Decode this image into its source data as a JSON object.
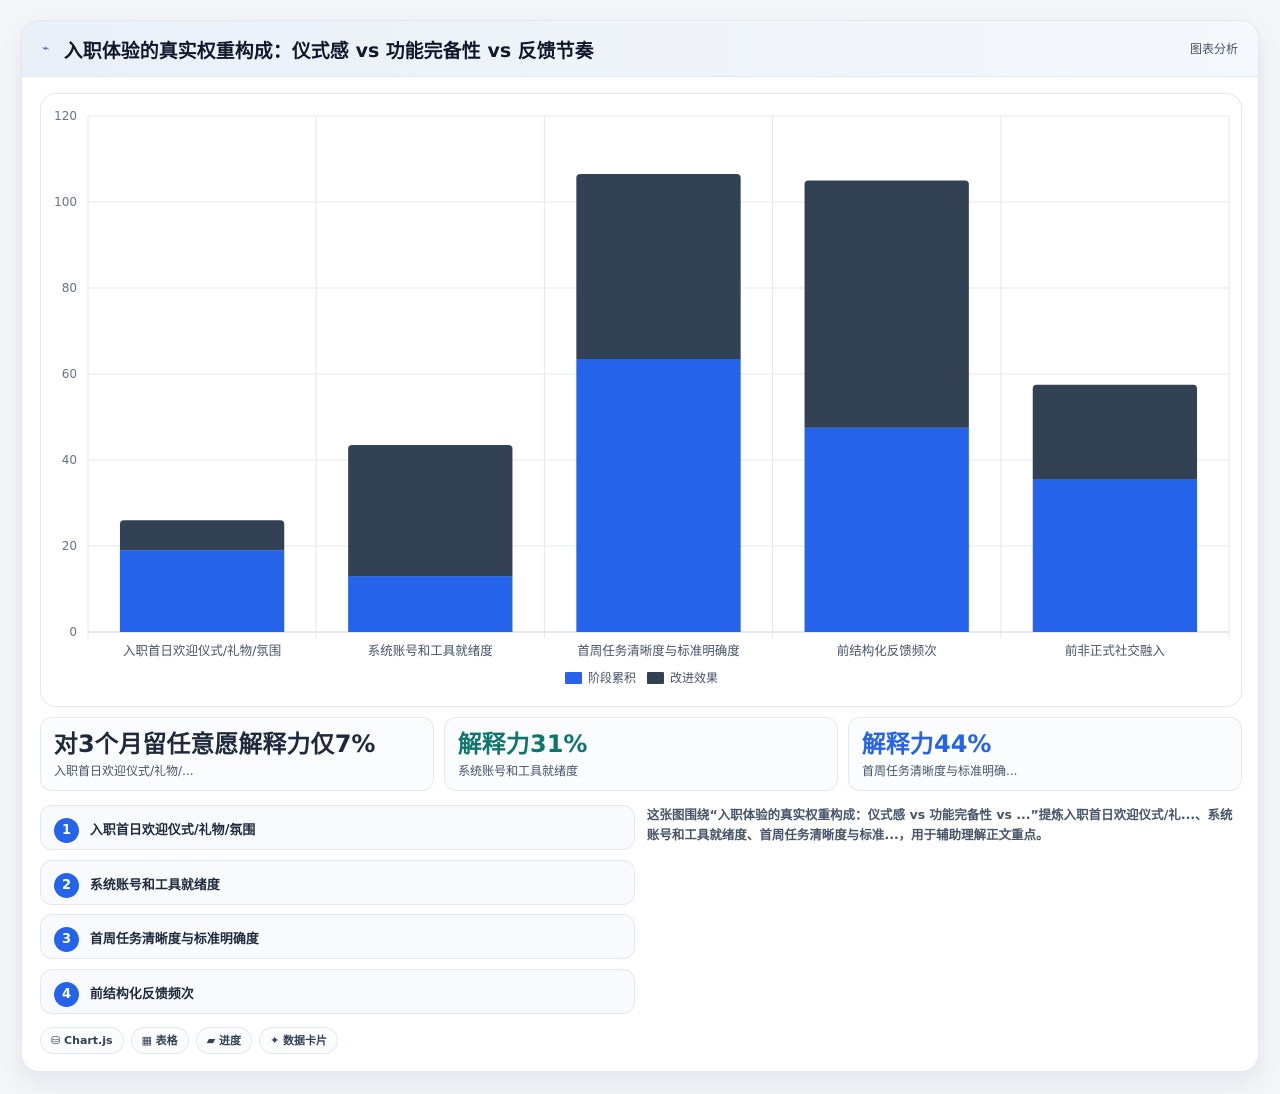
{
  "header": {
    "title": "入职体验的真实权重构成：仪式感 vs 功能完备性 vs 反馈节奏",
    "tag": "图表分析"
  },
  "chart_data": {
    "type": "bar",
    "stacked": true,
    "categories": [
      "入职首日欢迎仪式/礼物/氛围",
      "系统账号和工具就绪度",
      "首周任务清晰度与标准明确度",
      "前结构化反馈频次",
      "前非正式社交融入"
    ],
    "series": [
      {
        "name": "阶段累积",
        "color": "#2563eb",
        "values": [
          19,
          13,
          63.5,
          47.5,
          35.5
        ]
      },
      {
        "name": "改进效果",
        "color": "#334155",
        "values": [
          7,
          30.5,
          43,
          57.5,
          22
        ]
      }
    ],
    "ylim": [
      0,
      120
    ],
    "yticks": [
      0,
      20,
      40,
      60,
      80,
      100,
      120
    ],
    "grid": true,
    "legend": "bottom"
  },
  "stats": [
    {
      "big": "对3个月留任意愿解释力仅7%",
      "sub": "入职首日欢迎仪式/礼物/...",
      "color": "#1e293b"
    },
    {
      "big": "解释力31%",
      "sub": "系统账号和工具就绪度",
      "color": "#0f766e"
    },
    {
      "big": "解释力44%",
      "sub": "首周任务清晰度与标准明确...",
      "color": "#2563eb"
    }
  ],
  "steps": [
    {
      "num": "1",
      "label": "入职首日欢迎仪式/礼物/氛围"
    },
    {
      "num": "2",
      "label": "系统账号和工具就绪度"
    },
    {
      "num": "3",
      "label": "首周任务清晰度与标准明确度"
    },
    {
      "num": "4",
      "label": "前结构化反馈频次"
    }
  ],
  "description": "这张图围绕“入职体验的真实权重构成：仪式感 vs 功能完备性 vs ...”提炼入职首日欢迎仪式/礼...、系统账号和工具就绪度、首周任务清晰度与标准...，用于辅助理解正文重点。",
  "chips": [
    "⛁ Chart.js",
    "▦ 表格",
    "▰ 进度",
    "✦ 数据卡片"
  ]
}
